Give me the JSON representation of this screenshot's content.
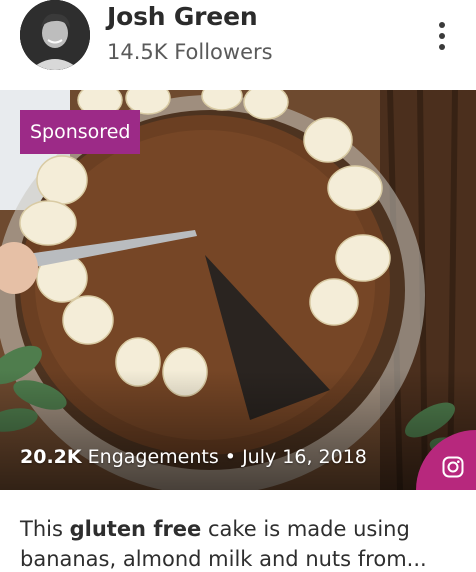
{
  "author": {
    "name": "Josh Green",
    "followers": "14.5K Followers"
  },
  "badge": {
    "sponsored": "Sponsored"
  },
  "stats": {
    "engagements_count": "20.2K",
    "engagements_label": "Engagements",
    "separator": "•",
    "date": "July 16, 2018"
  },
  "caption": {
    "prefix": "This ",
    "highlight": "gluten free",
    "suffix": " cake is made using bananas, almond milk and nuts from..."
  },
  "icons": {
    "more": "more-vertical-icon",
    "platform": "instagram-icon"
  },
  "colors": {
    "sponsored_bg": "#9c2a87",
    "instagram_badge": "#b7287d",
    "text": "#2b2b2b"
  }
}
